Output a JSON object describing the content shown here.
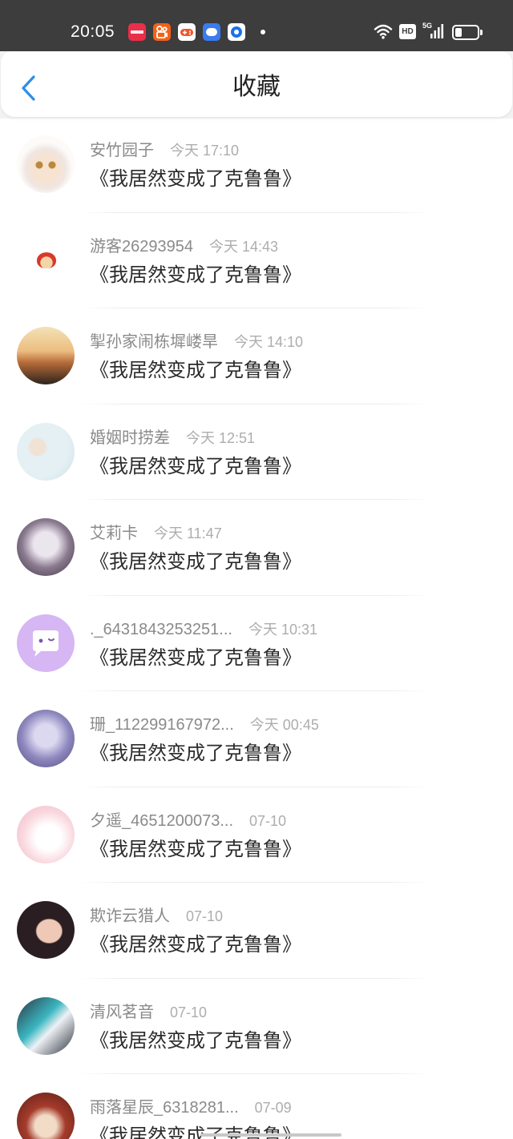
{
  "status_bar": {
    "time": "20:05",
    "app_icons": [
      "xiaohongshu-icon",
      "kuaishou-icon",
      "game-center-icon",
      "message-bubble-icon",
      "browser-icon"
    ],
    "hd_label": "HD",
    "network_label": "5G",
    "battery_level": 0.3
  },
  "header": {
    "back_icon": "chevron-left-icon",
    "title": "收藏"
  },
  "colors": {
    "accent": "#2b8fea",
    "status_bar": "#3d3d3d",
    "user_name": "#8a8a8a",
    "timestamp": "#adadad",
    "item_title": "#2b2b2b"
  },
  "favorites": [
    {
      "user": "安竹园子",
      "time": "今天 17:10",
      "title": "《我居然变成了克鲁鲁》"
    },
    {
      "user": "游客26293954",
      "time": "今天 14:43",
      "title": "《我居然变成了克鲁鲁》"
    },
    {
      "user": "掣孙家闹栋墀嵝旱",
      "time": "今天 14:10",
      "title": "《我居然变成了克鲁鲁》"
    },
    {
      "user": "婚姻时捞差",
      "time": "今天 12:51",
      "title": "《我居然变成了克鲁鲁》"
    },
    {
      "user": "艾莉卡",
      "time": "今天 11:47",
      "title": "《我居然变成了克鲁鲁》"
    },
    {
      "user": "._6431843253251...",
      "time": "今天 10:31",
      "title": "《我居然变成了克鲁鲁》",
      "avatar_icon": "chat-bubble-icon"
    },
    {
      "user": "珊_112299167972...",
      "time": "今天 00:45",
      "title": "《我居然变成了克鲁鲁》"
    },
    {
      "user": "夕遥_4651200073...",
      "time": "07-10",
      "title": "《我居然变成了克鲁鲁》"
    },
    {
      "user": "欺诈云猎人",
      "time": "07-10",
      "title": "《我居然变成了克鲁鲁》"
    },
    {
      "user": "清风茗音",
      "time": "07-10",
      "title": "《我居然变成了克鲁鲁》"
    },
    {
      "user": "雨落星辰_6318281...",
      "time": "07-09",
      "title": "《我居然变成了克鲁鲁》"
    }
  ]
}
